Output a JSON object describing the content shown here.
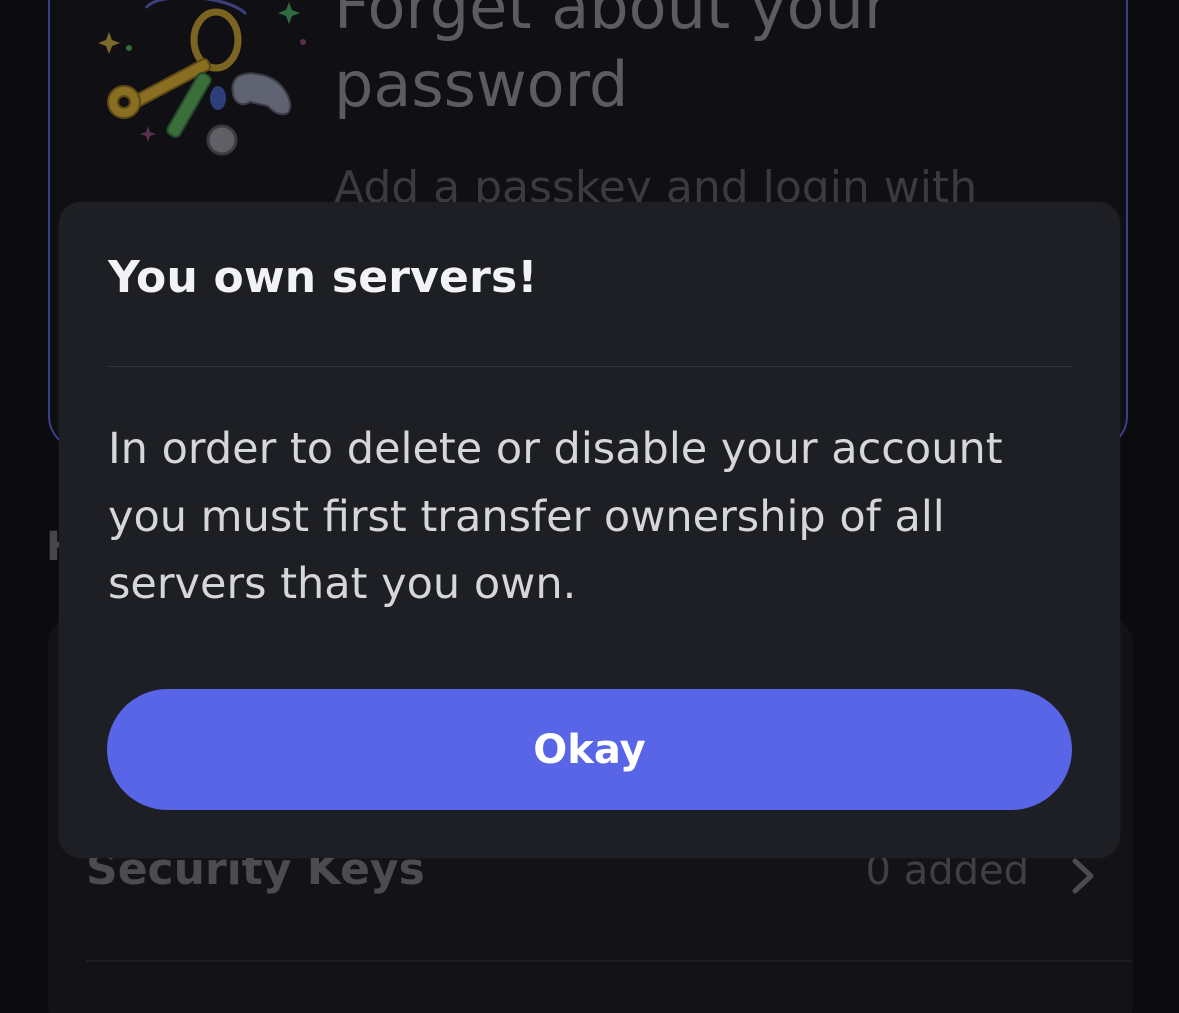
{
  "background": {
    "promo": {
      "title": "Forget about your password",
      "subtitle": "Add a passkey and login with"
    },
    "section_header_fragment": "H",
    "security_keys": {
      "label": "Security Keys",
      "value": "0 added"
    }
  },
  "dialog": {
    "title": "You own servers!",
    "message": "In order to delete or disable your account you must first transfer ownership of all servers that you own.",
    "confirm_label": "Okay"
  },
  "colors": {
    "button_accent": "#5865e6",
    "dialog_background": "#1e1f24",
    "page_background": "#0c0c10",
    "promo_border": "#3b3f86"
  },
  "icons": {
    "illustration": "keychain-illustration",
    "row_chevron": "chevron-right-icon"
  }
}
